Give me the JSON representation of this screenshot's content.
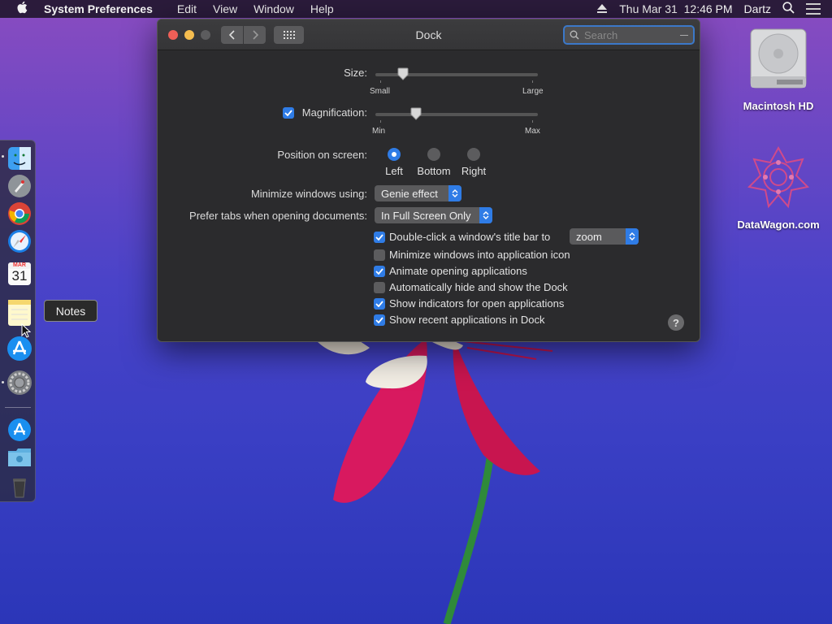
{
  "menubar": {
    "app_name": "System Preferences",
    "menus": [
      "Edit",
      "View",
      "Window",
      "Help"
    ],
    "datetime": "Thu Mar 31  12:46 PM",
    "user": "Dartz"
  },
  "desktop": {
    "icons": [
      {
        "label": "Macintosh HD",
        "icon": "hard-drive-icon"
      },
      {
        "label": "DataWagon.com",
        "icon": "datawagon-logo-icon"
      }
    ]
  },
  "dock": {
    "apps": [
      {
        "name": "Finder",
        "icon": "finder-icon",
        "running": true
      },
      {
        "name": "Launchpad",
        "icon": "launchpad-icon",
        "running": false
      },
      {
        "name": "Chrome",
        "icon": "chrome-icon",
        "running": false
      },
      {
        "name": "Safari",
        "icon": "safari-icon",
        "running": false
      },
      {
        "name": "Calendar",
        "icon": "calendar-icon",
        "running": false
      },
      {
        "name": "Notes",
        "icon": "notes-icon",
        "running": false
      },
      {
        "name": "App Store",
        "icon": "app-store-icon",
        "running": false
      },
      {
        "name": "System Preferences",
        "icon": "system-preferences-icon",
        "running": true
      }
    ],
    "calendar_month": "MAR",
    "calendar_day": "31",
    "tooltip": "Notes"
  },
  "window": {
    "title": "Dock",
    "search_placeholder": "Search",
    "size": {
      "label": "Size:",
      "min_label": "Small",
      "max_label": "Large",
      "value": 0.17
    },
    "magnification": {
      "label": "Magnification:",
      "checked": true,
      "min_label": "Min",
      "max_label": "Max",
      "value": 0.25
    },
    "position": {
      "label": "Position on screen:",
      "options": [
        "Left",
        "Bottom",
        "Right"
      ],
      "selected": "Left"
    },
    "minimize_using": {
      "label": "Minimize windows using:",
      "value": "Genie effect"
    },
    "prefer_tabs": {
      "label": "Prefer tabs when opening documents:",
      "value": "In Full Screen Only"
    },
    "double_click": {
      "label": "Double-click a window's title bar to",
      "checked": true,
      "value": "zoom"
    },
    "checkboxes": [
      {
        "label": "Minimize windows into application icon",
        "checked": false
      },
      {
        "label": "Animate opening applications",
        "checked": true
      },
      {
        "label": "Automatically hide and show the Dock",
        "checked": false
      },
      {
        "label": "Show indicators for open applications",
        "checked": true
      },
      {
        "label": "Show recent applications in Dock",
        "checked": true
      }
    ],
    "help": "?"
  },
  "colors": {
    "accent": "#2f7ce6",
    "window_bg": "#2b2b2d",
    "close": "#ee5f57",
    "minimize": "#f5bd4f"
  }
}
